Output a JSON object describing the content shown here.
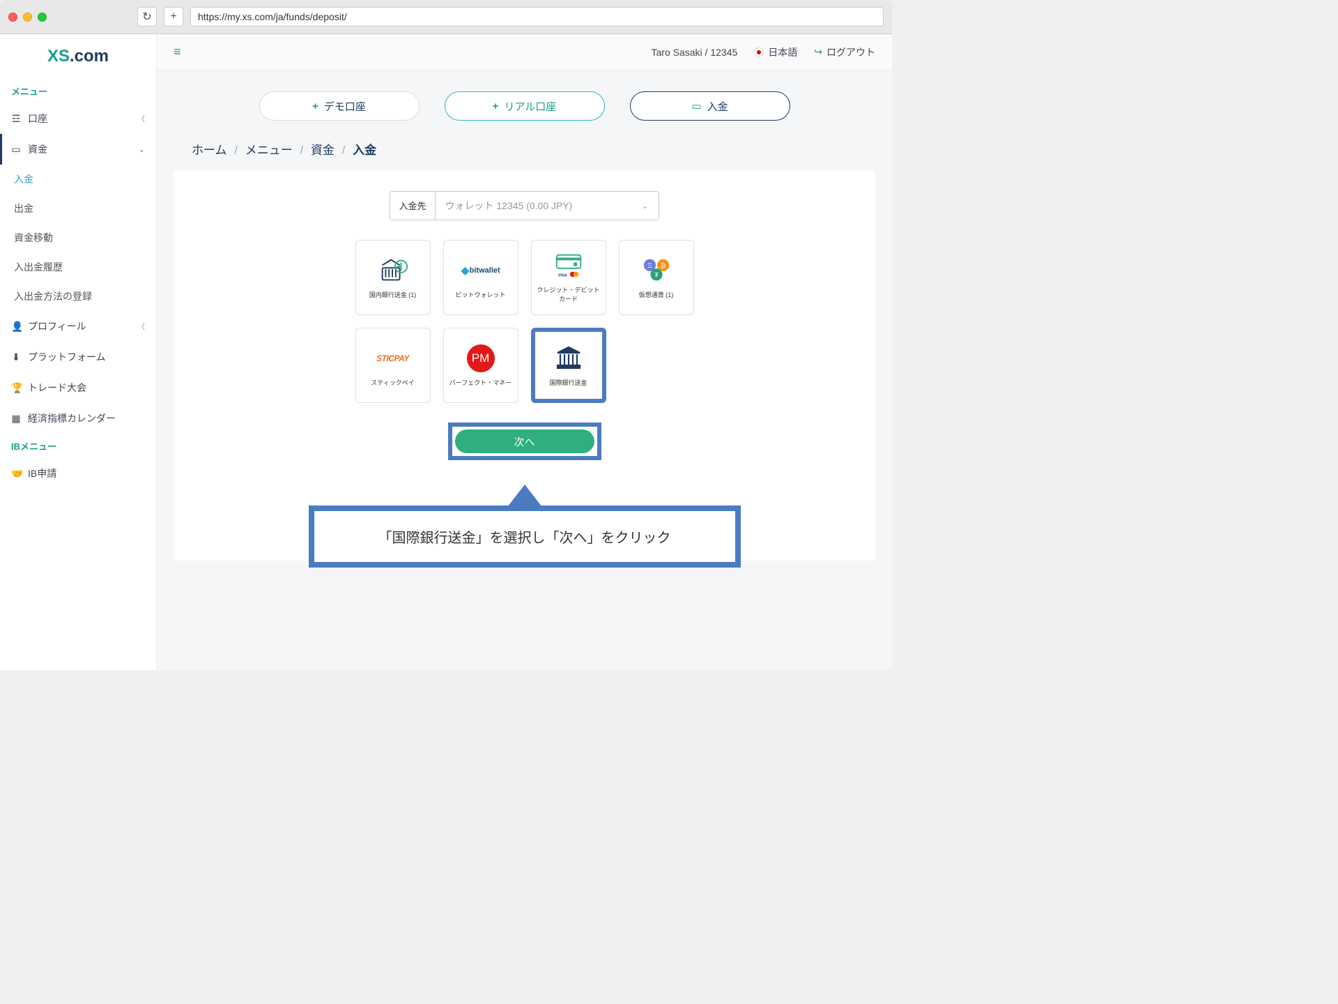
{
  "browser": {
    "url": "https://my.xs.com/ja/funds/deposit/"
  },
  "logo": {
    "xs": "XS",
    "dotcom": ".com"
  },
  "sidebar": {
    "menu_label": "メニュー",
    "ib_label": "IBメニュー",
    "accounts": {
      "label": "口座",
      "icon": "list"
    },
    "funds": {
      "label": "資金",
      "icon": "card",
      "items": [
        {
          "label": "入金"
        },
        {
          "label": "出金"
        },
        {
          "label": "資金移動"
        },
        {
          "label": "入出金履歴"
        },
        {
          "label": "入出金方法の登録"
        }
      ]
    },
    "profile": {
      "label": "プロフィール",
      "icon": "user"
    },
    "platform": {
      "label": "プラットフォーム",
      "icon": "download"
    },
    "contest": {
      "label": "トレード大会",
      "icon": "trophy"
    },
    "calendar": {
      "label": "経済指標カレンダー",
      "icon": "calendar"
    },
    "ib_apply": {
      "label": "IB申請",
      "icon": "handshake"
    }
  },
  "topbar": {
    "user": "Taro Sasaki / 12345",
    "language": "日本語",
    "logout": "ログアウト"
  },
  "actions": {
    "demo": "デモ口座",
    "real": "リアル口座",
    "deposit": "入金"
  },
  "breadcrumb": {
    "home": "ホーム",
    "menu": "メニュー",
    "funds": "資金",
    "current": "入金"
  },
  "deposit": {
    "label": "入金先",
    "placeholder": "ウォレット 12345 (0.00 JPY)"
  },
  "methods": [
    {
      "name": "国内銀行送金 (1)",
      "type": "bank-domestic"
    },
    {
      "name": "ビットウォレット",
      "type": "bitwallet"
    },
    {
      "name": "クレジット・デビットカード",
      "type": "credit"
    },
    {
      "name": "仮想通貨 (1)",
      "type": "crypto"
    },
    {
      "name": "スティックペイ",
      "type": "sticpay"
    },
    {
      "name": "パーフェクト・マネー",
      "type": "perfectmoney"
    },
    {
      "name": "国際銀行送金",
      "type": "bank-intl",
      "highlighted": true
    }
  ],
  "next_button": "次へ",
  "callout": "「国際銀行送金」を選択し「次へ」をクリック"
}
